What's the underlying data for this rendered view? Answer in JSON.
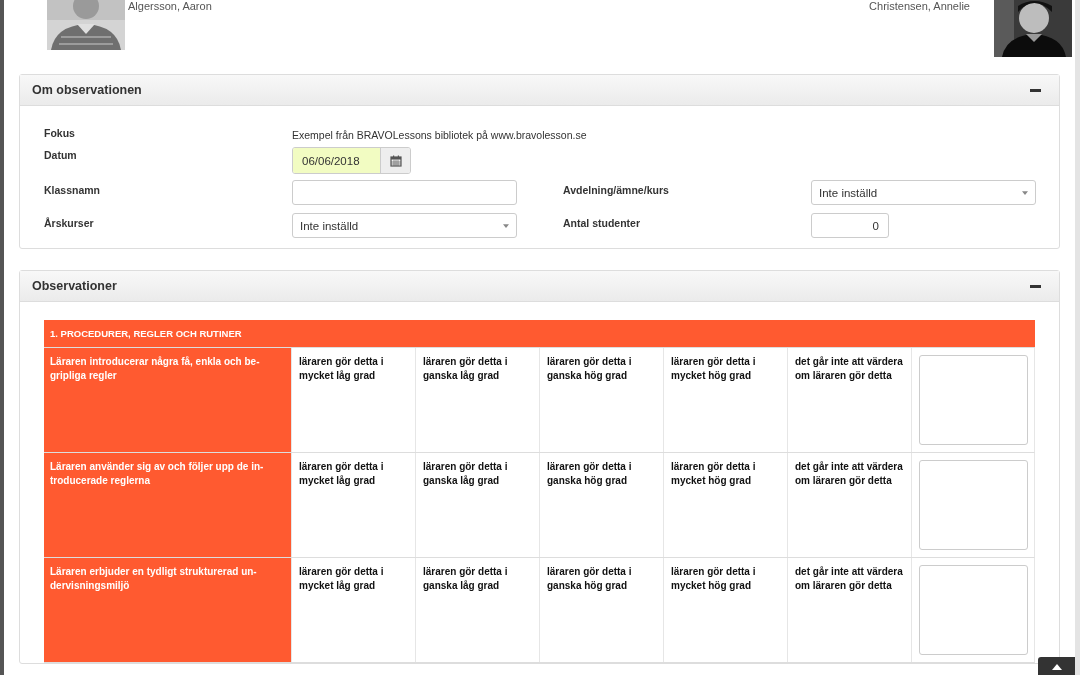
{
  "observed": {
    "name": "Algersson, Aaron"
  },
  "observer": {
    "name": "Christensen, Annelie"
  },
  "about": {
    "title": "Om observationen",
    "expanded": true,
    "rows": [
      [
        {
          "label": "Fokus",
          "kind": "text",
          "value": "Exempel från BRAVOLessons bibliotek på www.bravolesson.se"
        }
      ],
      [
        {
          "label": "Datum",
          "kind": "date",
          "value": "06/06/2018"
        }
      ],
      [
        {
          "label": "Klassnamn",
          "kind": "input"
        },
        {
          "label": "Avdelning/ämne/kurs",
          "kind": "select",
          "value": "Inte inställd"
        }
      ],
      [
        {
          "label": "Årskurser",
          "kind": "select",
          "value": "Inte inställd"
        },
        {
          "label": "Antal studenter",
          "kind": "number",
          "value": "0"
        }
      ]
    ]
  },
  "observations": {
    "title": "Observationer",
    "expanded": true,
    "category": "1. PROCEDURER, REGLER OCH RUTINER",
    "items": [
      {
        "statement": "Läraren introducerar några få, enkla och be-gripliga regler",
        "options": [
          "läraren gör detta i mycket låg grad",
          "läraren gör detta i ganska låg grad",
          "läraren gör detta i ganska hög grad",
          "läraren gör detta i mycket hög grad",
          "det går inte att värdera om läraren gör detta"
        ]
      },
      {
        "statement": "Läraren använder sig av och följer upp de in-troducerade reglerna",
        "options": [
          "läraren gör detta i mycket låg grad",
          "läraren gör detta i ganska låg grad",
          "läraren gör detta i ganska hög grad",
          "läraren gör detta i mycket hög grad",
          "det går inte att värdera om läraren gör detta"
        ]
      },
      {
        "statement": "Läraren erbjuder en tydligt strukturerad un-dervisningsmiljö",
        "options": [
          "läraren gör detta i mycket låg grad",
          "läraren gör detta i ganska låg grad",
          "läraren gör detta i ganska hög grad",
          "läraren gör detta i mycket hög grad",
          "det går inte att värdera om läraren gör detta"
        ]
      }
    ]
  }
}
